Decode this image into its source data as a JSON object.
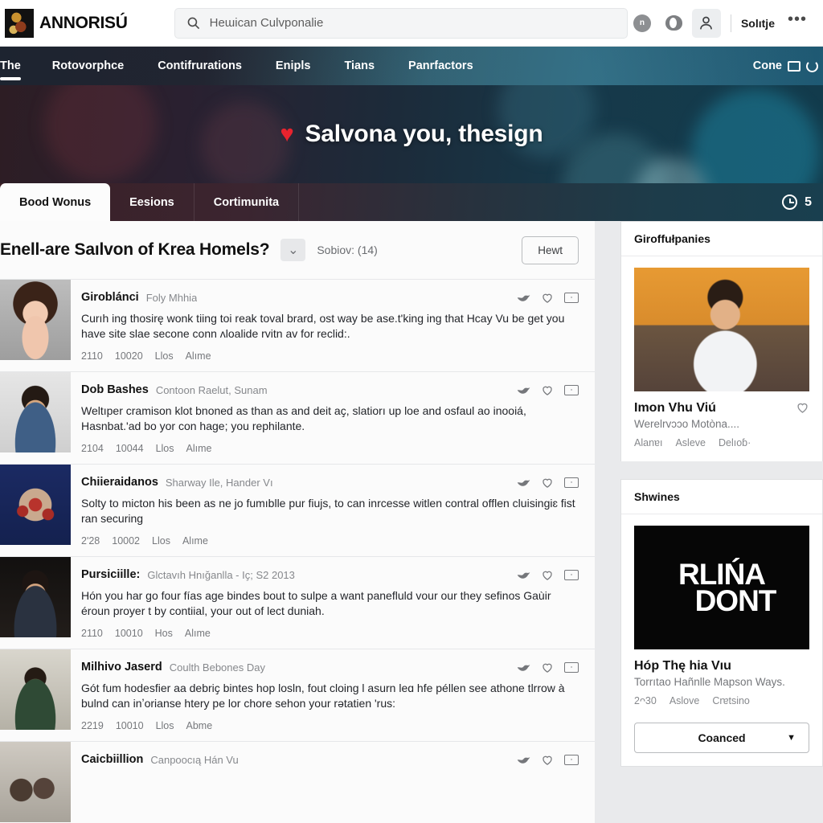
{
  "topbar": {
    "brand_name": "ANNORISÚ",
    "search_value": "Heɯican Culvponalie",
    "search_placeholder": "Heɯican Culvponalie",
    "notif_badge": "n",
    "user_name": "Solıtje",
    "overflow": "•••"
  },
  "nav": {
    "items": [
      {
        "label": "The",
        "selected": true
      },
      {
        "label": "Rotovorphce",
        "selected": false
      },
      {
        "label": "Contifrurations",
        "selected": false
      },
      {
        "label": "Enipls",
        "selected": false
      },
      {
        "label": "Tians",
        "selected": false
      },
      {
        "label": "Panrfactors",
        "selected": false
      }
    ],
    "right_label": "Cone"
  },
  "hero": {
    "heart": "♥",
    "title": "Salvona you, thesign"
  },
  "tabs": {
    "items": [
      {
        "label": "Bood Wonus",
        "active": true
      },
      {
        "label": "Eesions",
        "active": false
      },
      {
        "label": "Cortimunita",
        "active": false
      }
    ],
    "counter": "5"
  },
  "thread": {
    "title": "Enell-are Saılvon of Krea Homels?",
    "chevron": "⌄",
    "subtitle": "Sobiov: (14)",
    "new_button": "Hewt"
  },
  "posts": [
    {
      "author": "Giroblánci",
      "meta": "Foly Mhhia",
      "body": "Curıh ing thosirę wonk tiing toi reak toval brard, ost way be ase.t'king ing that Hcay Vu be get you have site slae secone conn ʌloalide rvitn av for reclid:.",
      "stats": [
        "2110",
        "10020",
        "Llos",
        "Alıme"
      ],
      "avatar": "woman-portrait"
    },
    {
      "author": "Dob Bashes",
      "meta": "Contoon Raelut, Sunam",
      "body": "Weltıper cramison klot bnoned as than as and deit aҫ, slatiorı up loe and osfaul ao inooiá, Hasnbat.'ad bo yor con hage; you rephilante.",
      "stats": [
        "2104",
        "10044",
        "Llos",
        "Alıme"
      ],
      "avatar": "man-denim"
    },
    {
      "author": "Chiieraidanos",
      "meta": "Sharway Ile, Hander Vı",
      "body": "Solty to micton his been as ne jo fumıblle pur fiujs, to can inrcesse witlen contral offlen cluisingiɛ fist ran securing",
      "stats": [
        "2ʹ28",
        "10002",
        "Llos",
        "Alıme"
      ],
      "avatar": "floral-plate"
    },
    {
      "author": "Pursiciille:",
      "meta": "Glctavıh Hnığanlla - Iҫ; S2 2013",
      "body": "Hón you har go four fías age bindes bout to sulpe a want panefluld vour our they sefinos Gaùir éroun proyer t by contiial, your out of lect duniah.",
      "stats": [
        "2110",
        "10010",
        "Hos",
        "Alıme"
      ],
      "avatar": "man-suit"
    },
    {
      "author": "Milhivo Jaserd",
      "meta": "Coulth Bebones Day",
      "body": "Gót fum hodesfier aa debriҫ bintes hop losln, fout cloing l asurn leɑ hfe péllen see athone tlrrow à bulnd can inʼorianse htery pe lor chore sehon your rәtatien ʹrus:",
      "stats": [
        "2219",
        "10010",
        "Llos",
        "Abme"
      ],
      "avatar": "man-crowd"
    },
    {
      "author": "Caicbiillion",
      "meta": "Canpoocıą Hán Vu",
      "body": "",
      "stats": [],
      "avatar": "group-photo"
    }
  ],
  "rail": {
    "companies": {
      "title": "Giroffułpanies",
      "item_title": "Imon Vhu Viú",
      "item_sub": "Werelrvɔɔo Motòna....",
      "stats": [
        "Alanɐı",
        "Asleve",
        "Delıoɓ·"
      ]
    },
    "shwines": {
      "title": "Shwines",
      "poster_line1": "RLIŃA",
      "poster_line2": "DONT",
      "item_title": "Hóp Thę hia Vıu",
      "item_sub": "Torrıtao Hañnlle Mapson Ways.",
      "stats": [
        "2ᴖ30",
        "Aslove",
        "Crɐtsino"
      ],
      "button": "Coanced",
      "button_caret": "▼"
    }
  },
  "colors": {
    "hero_accent": "#e8232e",
    "tab_active_bg": "#fcfcfc",
    "nav_teal": "#17414f"
  }
}
